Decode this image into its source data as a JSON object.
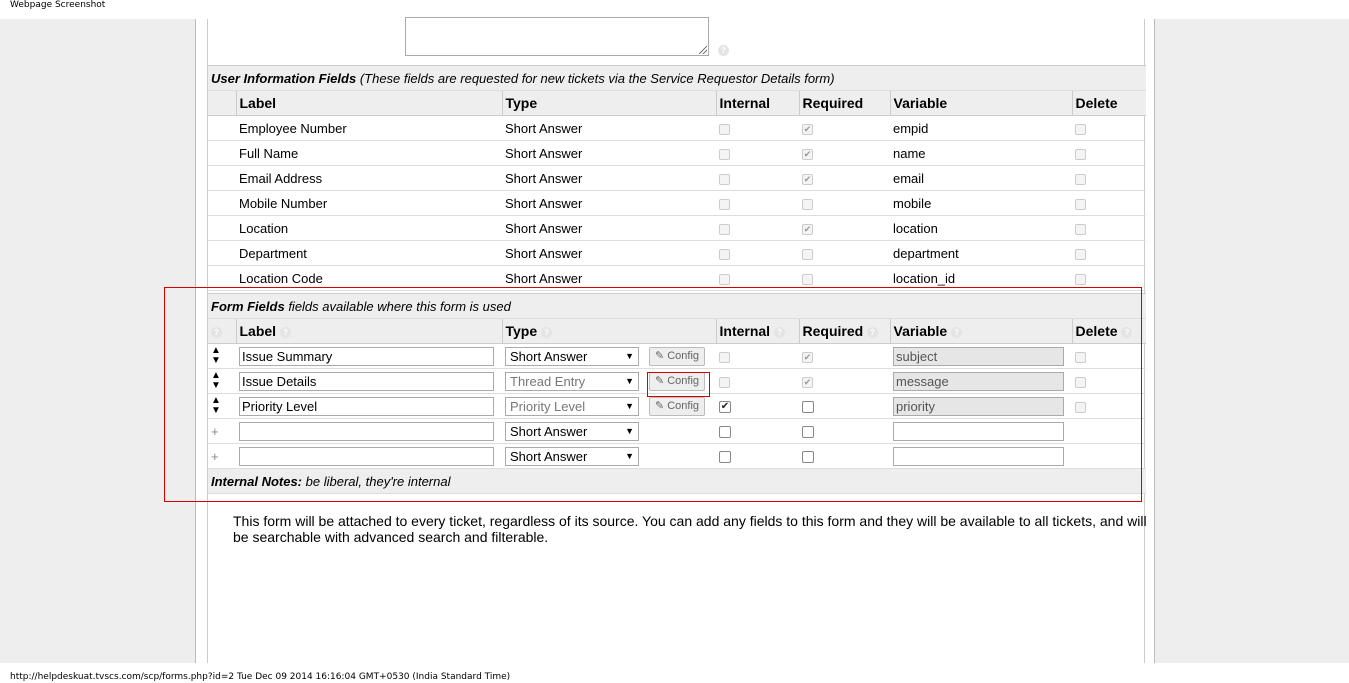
{
  "print_header": "Webpage Screenshot",
  "print_footer": "http://helpdeskuat.tvscs.com/scp/forms.php?id=2 Tue Dec 09 2014 16:16:04 GMT+0530 (India Standard Time)",
  "user_info": {
    "title": "User Information Fields",
    "subtitle": "(These fields are requested for new tickets via the Service Requestor Details form)",
    "columns": [
      "Label",
      "Type",
      "Internal",
      "Required",
      "Variable",
      "Delete"
    ],
    "rows": [
      {
        "label": "Employee Number",
        "type": "Short Answer",
        "required": true,
        "variable": "empid"
      },
      {
        "label": "Full Name",
        "type": "Short Answer",
        "required": true,
        "variable": "name"
      },
      {
        "label": "Email Address",
        "type": "Short Answer",
        "required": true,
        "variable": "email"
      },
      {
        "label": "Mobile Number",
        "type": "Short Answer",
        "required": false,
        "variable": "mobile"
      },
      {
        "label": "Location",
        "type": "Short Answer",
        "required": true,
        "variable": "location"
      },
      {
        "label": "Department",
        "type": "Short Answer",
        "required": false,
        "variable": "department"
      },
      {
        "label": "Location Code",
        "type": "Short Answer",
        "required": false,
        "variable": "location_id"
      }
    ]
  },
  "form_fields": {
    "title": "Form Fields",
    "subtitle": "fields available where this form is used",
    "columns": [
      "Label",
      "Type",
      "Internal",
      "Required",
      "Variable",
      "Delete"
    ],
    "config_label": "Config",
    "rows": [
      {
        "label": "Issue Summary",
        "type": "Short Answer",
        "variable": "subject"
      },
      {
        "label": "Issue Details",
        "type": "Thread Entry",
        "variable": "message"
      },
      {
        "label": "Priority Level",
        "type": "Priority Level",
        "variable": "priority"
      },
      {
        "label": "",
        "type": "Short Answer",
        "variable": ""
      },
      {
        "label": "",
        "type": "Short Answer",
        "variable": ""
      }
    ]
  },
  "internal_notes": {
    "title": "Internal Notes:",
    "subtitle": "be liberal, they're internal"
  },
  "description": "This form will be attached to every ticket, regardless of its source. You can add any fields to this form and they will be available to all tickets, and will be searchable with advanced search and filterable."
}
